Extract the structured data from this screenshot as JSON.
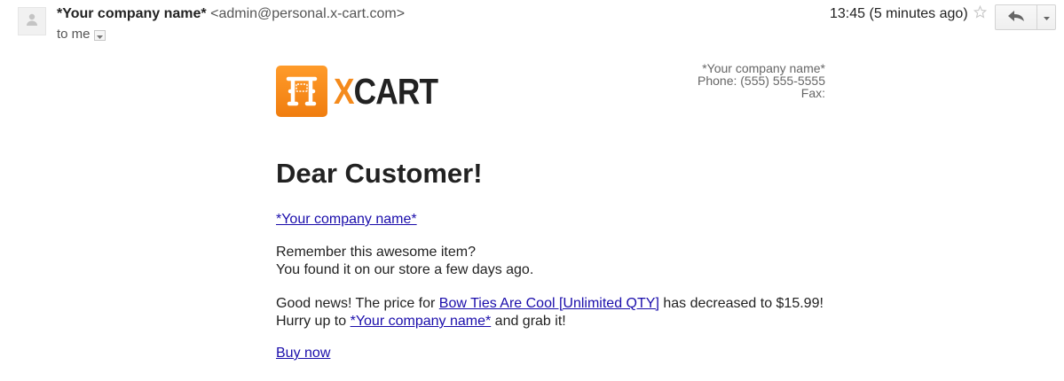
{
  "header": {
    "sender_name": "*Your company name*",
    "sender_email": "<admin@personal.x-cart.com>",
    "to_label": "to me",
    "time": "13:45 (5 minutes ago)"
  },
  "icons": {
    "avatar": "person-icon",
    "star": "star-icon",
    "reply": "reply-icon",
    "more": "chevron-down-icon",
    "to_details": "chevron-down-icon"
  },
  "email": {
    "logo": {
      "letter_x": "X",
      "letter_rest": "CART",
      "accent_color": "#f48a1c"
    },
    "company_info": {
      "name": "*Your company name*",
      "phone": "Phone: (555) 555-5555",
      "fax": "Fax:"
    },
    "greeting": "Dear Customer!",
    "company_link": "*Your company name*",
    "remember_line1": "Remember this awesome item?",
    "remember_line2": "You found it on our store a few days ago.",
    "news_prefix": "Good news! The price for ",
    "product_link": "Bow Ties Are Cool [Unlimited QTY]",
    "news_suffix": " has decreased to $15.99!",
    "hurry_prefix": "Hurry up to ",
    "hurry_company_link": "*Your company name*",
    "hurry_suffix": " and grab it!",
    "buy_now": "Buy now"
  }
}
